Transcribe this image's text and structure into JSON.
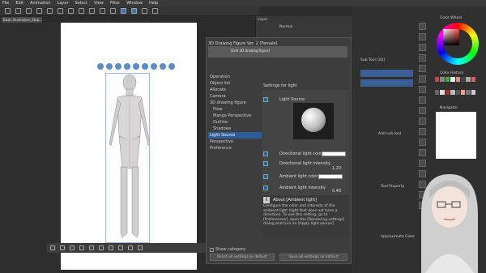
{
  "menu": [
    "File",
    "Edit",
    "Animation",
    "Layer",
    "Select",
    "View",
    "Filter",
    "Window",
    "Help"
  ],
  "document_tab": "Basic illustration_Stop...",
  "dialog": {
    "title": "3D Drawing Figure Ver. 2 (Female)",
    "subtitle": "[Edit 3D drawing figure]",
    "sidebar": [
      "Operation",
      "Object list",
      "Allocate",
      "Camera",
      "3D drawing figure",
      "Pose",
      "Manga Perspective",
      "Outline",
      "Shadows",
      "Light Source",
      "Perspective",
      "Preference"
    ],
    "active_item": "Light Source",
    "settings_header": "Settings for light",
    "light_source_label": "Light Source",
    "directional_color_label": "Directional light color",
    "directional_intensity_label": "Directional light intensity",
    "directional_intensity_value": "1.20",
    "ambient_color_label": "Ambient light color",
    "ambient_intensity_label": "Ambient light intensity",
    "ambient_intensity_value": "0.40",
    "info_title": "About [Ambient light]",
    "info_body": "Configure the color and intensity of the ambient light (light that does not have a direction). To use this setting, go to [Preferences], open the [Rendering settings] dialog and turn on [Apply light source].",
    "show_category": "Show category",
    "reset_all_button": "Reset all settings to default",
    "save_all_button": "Save all settings as default"
  },
  "right_panels": {
    "layer_title": "Layer",
    "layer_mode": "Normal",
    "sub_tool": "Sub Tool [3D]",
    "color_wheel": "Color Wheel",
    "color_history": "Color History",
    "navigator": "Navigator",
    "tool_property": "Tool Property",
    "add_sub_tool": "Add sub tool",
    "approx_color": "Approximate Color"
  },
  "colors": {
    "accent": "#2f5d9c",
    "panel_bg": "#3d3d3d",
    "canvas": "#ffffff"
  }
}
